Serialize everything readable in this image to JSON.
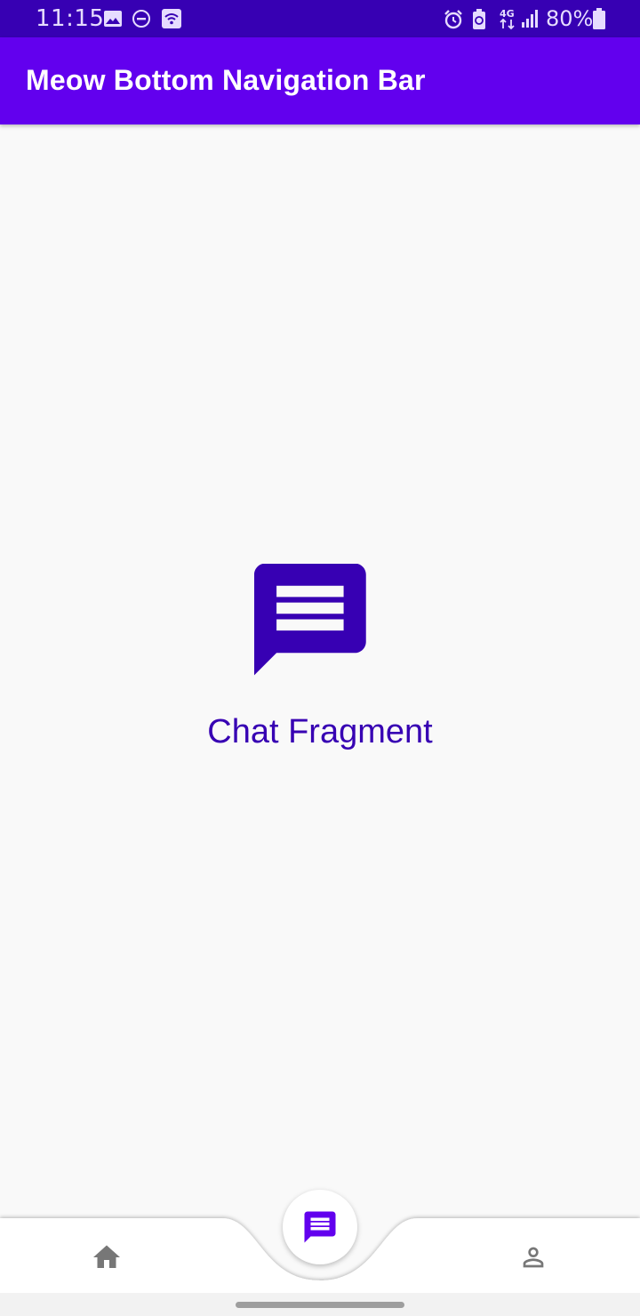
{
  "status_bar": {
    "time": "11:15",
    "battery": "80%",
    "icons": [
      "image-icon",
      "do-not-disturb-icon",
      "wifi-calling-icon",
      "alarm-icon",
      "battery-saver-icon",
      "network-4g-icon",
      "signal-icon",
      "battery-icon"
    ]
  },
  "app_bar": {
    "title": "Meow Bottom Navigation Bar"
  },
  "content": {
    "icon": "chat-icon",
    "label": "Chat Fragment"
  },
  "bottom_nav": {
    "items": [
      {
        "icon": "home-icon",
        "selected": false
      },
      {
        "icon": "chat-icon",
        "selected": true
      },
      {
        "icon": "person-icon",
        "selected": false
      }
    ]
  },
  "colors": {
    "status_bar": "#3700b3",
    "primary": "#6200ee",
    "primary_dark": "#3700b3",
    "background": "#f9f9f9",
    "nav_icon": "#777777"
  }
}
